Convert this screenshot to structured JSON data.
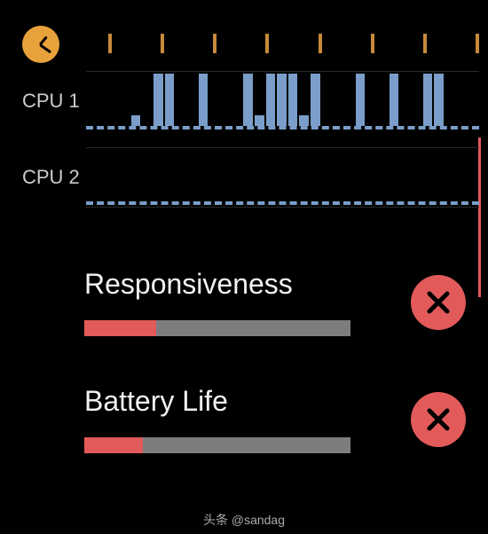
{
  "timeline": {
    "tickCount": 8
  },
  "chart_data": [
    {
      "type": "bar",
      "label": "CPU 1",
      "bars": [
        0,
        0,
        0,
        0,
        0.2,
        0,
        1,
        1,
        0,
        0,
        1,
        0,
        0,
        0,
        1,
        0.2,
        1,
        1,
        1,
        0.2,
        1,
        0,
        0,
        0,
        1,
        0,
        0,
        1,
        0,
        0,
        1,
        1,
        0,
        0,
        0
      ]
    },
    {
      "type": "bar",
      "label": "CPU 2",
      "bars": []
    }
  ],
  "metrics": [
    {
      "label": "Responsiveness",
      "value_pct": 27,
      "status": "bad"
    },
    {
      "label": "Battery Life",
      "value_pct": 22,
      "status": "bad"
    }
  ],
  "colors": {
    "accent_blue": "#7a9ec9",
    "accent_red": "#e25a5a",
    "clock": "#e8a23b",
    "track": "#7d7d80"
  },
  "attribution": "头条 @sandag"
}
